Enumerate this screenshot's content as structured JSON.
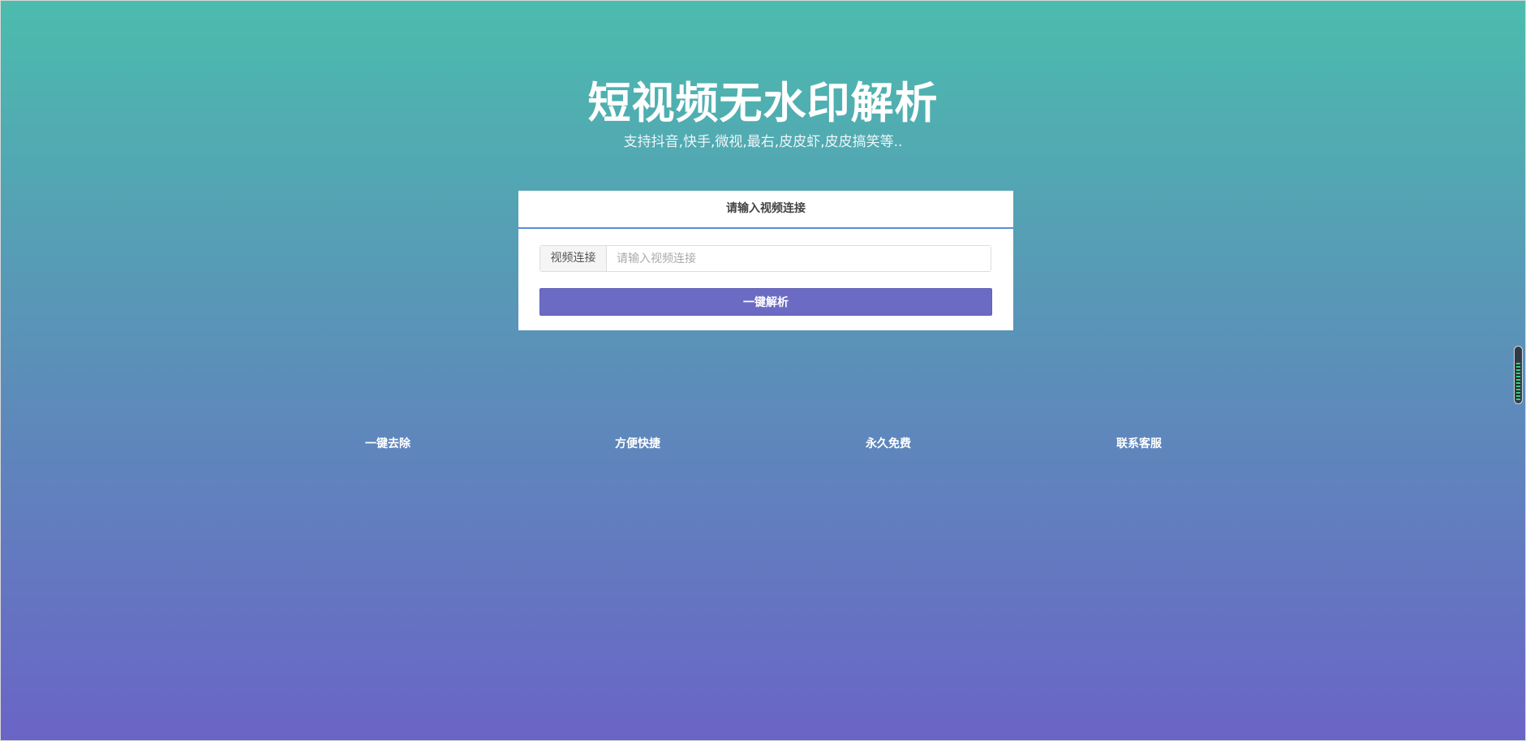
{
  "header": {
    "title": "短视频无水印解析",
    "subtitle": "支持抖音,快手,微视,最右,皮皮虾,皮皮搞笑等.."
  },
  "card": {
    "heading": "请输入视频连接",
    "input_label": "视频连接",
    "input_placeholder": "请输入视频连接",
    "input_value": "",
    "parse_button_label": "一键解析"
  },
  "features": [
    {
      "label": "一键去除"
    },
    {
      "label": "方便快捷"
    },
    {
      "label": "永久免费"
    },
    {
      "label": "联系客服"
    }
  ],
  "colors": {
    "gradient_top": "#4bbcad",
    "gradient_bottom": "#6a64c6",
    "button": "#6c6bc4",
    "header_underline": "#5b8cd6"
  }
}
